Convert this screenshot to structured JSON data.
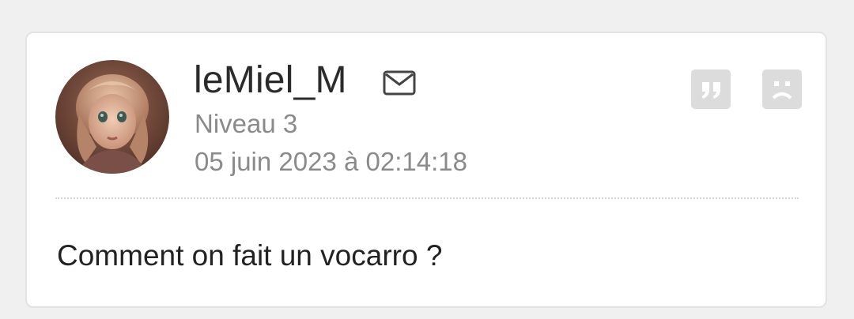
{
  "post": {
    "author": {
      "username": "leMiel_M",
      "level": "Niveau 3",
      "avatar": "avatar-image"
    },
    "date": "05 juin 2023 à 02:14:18",
    "message": "Comment on fait un vocarro ?",
    "icons": {
      "mail": "mail-icon",
      "quote": "quote-icon",
      "report": "sad-face-icon"
    }
  },
  "colors": {
    "background": "#f0f0f0",
    "card": "#ffffff",
    "username": "#2b2b2b",
    "meta": "#8a8a8a",
    "icon_button": "#dcdcdc"
  }
}
